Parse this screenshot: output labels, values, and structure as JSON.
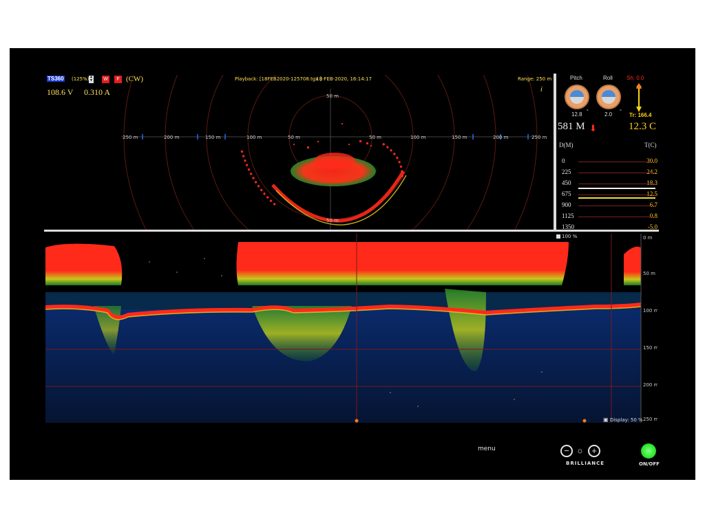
{
  "sonar": {
    "model": "TS360",
    "gain": "(125%)",
    "mode_buttons": [
      "W",
      "F"
    ],
    "mode": "(CW)",
    "voltage": "108.6 V",
    "current": "0.310 A",
    "playback": "Playback: [18FEB2020-125708.tgx  ]",
    "datetime": "18-FEB-2020, 16:14:17",
    "range": "Range: 250 m",
    "info_icon": "i",
    "horizontal_ticks": [
      "250 m",
      "200 m",
      "150 m",
      "100 m",
      "50 m",
      "50 m",
      "100 m",
      "150 m",
      "200 m",
      "250 m"
    ],
    "vertical_ticks": [
      "50 m",
      "50 m"
    ]
  },
  "sensors": {
    "pitch_label": "Pitch",
    "roll_label": "Roll",
    "pitch_value": "12.8",
    "roll_value": "2.0",
    "degree_mark": "°",
    "sh": "Sh: 0.0",
    "tr": "Tr: 166.4",
    "depth_reading": "581 M",
    "temp_reading": "12.3 C",
    "depth_header": "D(M)",
    "temp_header": "T(C)",
    "depth_rows": [
      "0",
      "225",
      "450",
      "675",
      "900",
      "1125",
      "1350"
    ],
    "temp_rows": [
      "30.0",
      "24.2",
      "18.3",
      "12.5",
      "6.7",
      "0.8",
      "-5.0"
    ],
    "temperature_profile_depths": [
      0,
      225,
      450,
      675,
      900,
      1125
    ],
    "temperature_profile_markers": [
      18.3,
      12.5
    ]
  },
  "echogram": {
    "top_marker": "100 %",
    "depth_ticks": [
      "0 m",
      "50 m",
      "100 m",
      "150 m",
      "200 m",
      "250 m"
    ],
    "display_label": "Display: 50 %",
    "icon_small": "▣"
  },
  "hardware": {
    "menu_label": "menu",
    "brilliance_label": "BRILLIANCE",
    "minus": "−",
    "plus": "+",
    "sun": "☼",
    "onoff_label": "ON/OFF"
  },
  "colors": {
    "accent_red": "#ff2a1a",
    "accent_yellow": "#ffe25a",
    "power_green": "#2ee82e"
  }
}
